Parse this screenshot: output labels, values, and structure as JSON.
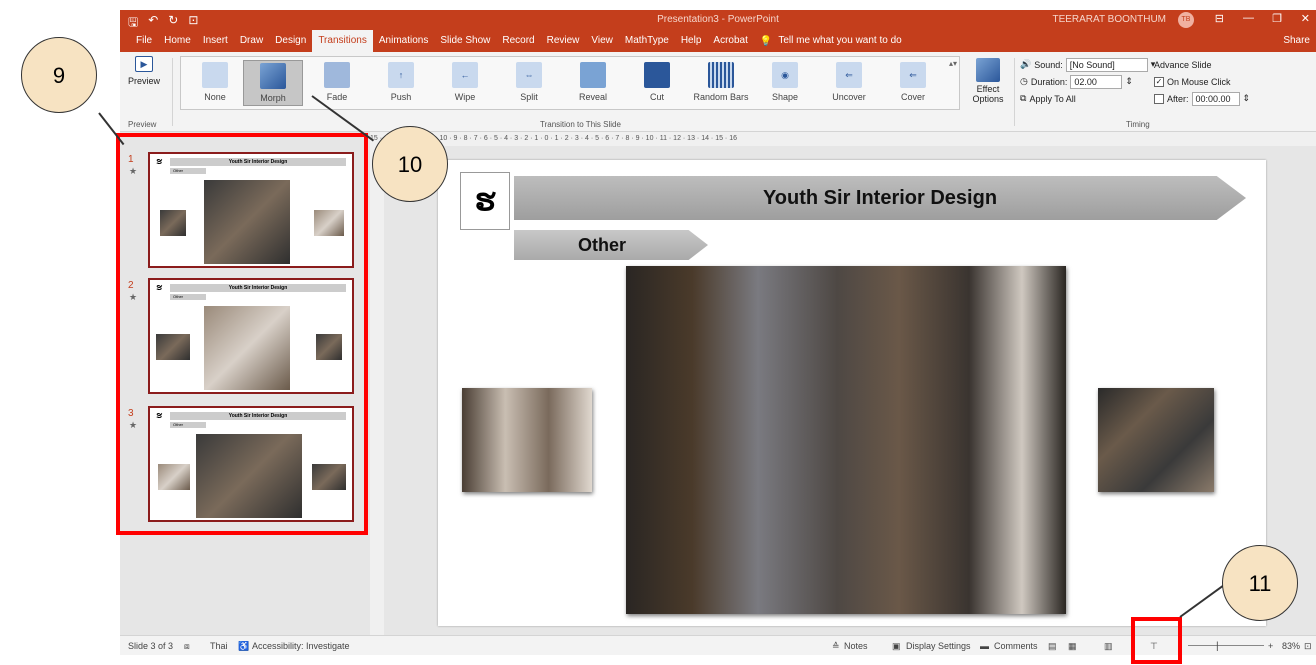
{
  "titlebar": {
    "app_title": "Presentation3 - PowerPoint",
    "user": "TEERARAT BOONTHUM",
    "avatar": "TB"
  },
  "menu": {
    "tabs": [
      "File",
      "Home",
      "Insert",
      "Draw",
      "Design",
      "Transitions",
      "Animations",
      "Slide Show",
      "Record",
      "Review",
      "View",
      "MathType",
      "Help",
      "Acrobat"
    ],
    "tell_me": "Tell me what you want to do",
    "share": "Share"
  },
  "ribbon": {
    "preview": "Preview",
    "preview_group": "Preview",
    "transitions": [
      "None",
      "Morph",
      "Fade",
      "Push",
      "Wipe",
      "Split",
      "Reveal",
      "Cut",
      "Random Bars",
      "Shape",
      "Uncover",
      "Cover"
    ],
    "transitions_group": "Transition to This Slide",
    "effect_options": "Effect Options",
    "sound_label": "Sound:",
    "sound_value": "[No Sound]",
    "duration_label": "Duration:",
    "duration_value": "02.00",
    "apply_all": "Apply To All",
    "timing_group": "Timing",
    "advance_label": "Advance Slide",
    "on_mouse_click": "On Mouse Click",
    "after_label": "After:",
    "after_value": "00:00.00"
  },
  "thumbnails": [
    {
      "num": "1",
      "title": "Youth Sir Interior Design",
      "tag": "Other"
    },
    {
      "num": "2",
      "title": "Youth Sir Interior Design",
      "tag": "Other"
    },
    {
      "num": "3",
      "title": "Youth Sir Interior Design",
      "tag": "Other"
    }
  ],
  "ruler": "15 · 14 · 13 · 12 · 11 · 10 · 9 · 8 · 7 · 6 · 5 · 4 · 3 · 2 · 1 · 0 · 1 · 2 · 3 · 4 · 5 · 6 · 7 · 8 · 9 · 10 · 11 · 12 · 13 · 14 · 15 · 16",
  "slide": {
    "title": "Youth Sir Interior Design",
    "tag": "Other",
    "logo": "ຮ"
  },
  "status": {
    "slide": "Slide 3 of 3",
    "lang": "Thai",
    "accessibility": "Accessibility: Investigate",
    "notes": "Notes",
    "display": "Display Settings",
    "comments": "Comments",
    "zoom": "83%"
  },
  "callouts": [
    "9",
    "10",
    "11"
  ],
  "colors": {
    "accent": "#c43e1c",
    "highlight": "#ff0000",
    "callout_fill": "#f7e3c2"
  }
}
